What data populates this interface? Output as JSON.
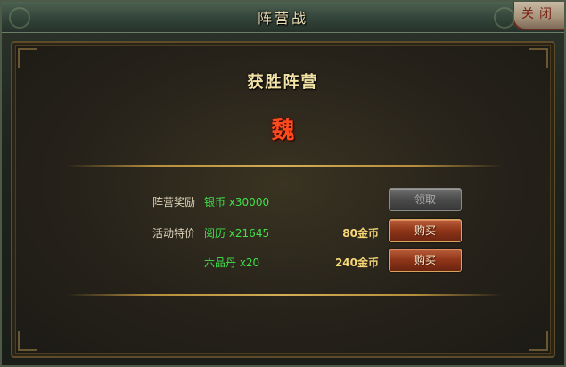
{
  "window": {
    "title": "阵营战",
    "close_label": "关闭"
  },
  "result": {
    "heading": "获胜阵营",
    "faction": "魏"
  },
  "rows": [
    {
      "label": "阵营奖励",
      "item": "银币 x30000",
      "price": "",
      "button": "领取",
      "button_state": "disabled"
    },
    {
      "label": "活动特价",
      "item": "阅历 x21645",
      "price": "80金币",
      "button": "购买",
      "button_state": "enabled"
    },
    {
      "label": "",
      "item": "六品丹 x20",
      "price": "240金币",
      "button": "购买",
      "button_state": "enabled"
    }
  ],
  "colors": {
    "heading": "#f2e2a6",
    "faction": "#ff4a1e",
    "item_text": "#41e04b",
    "price_text": "#f6d776",
    "buy_button": "#8e3518",
    "disabled_button": "#4b4b4b"
  }
}
